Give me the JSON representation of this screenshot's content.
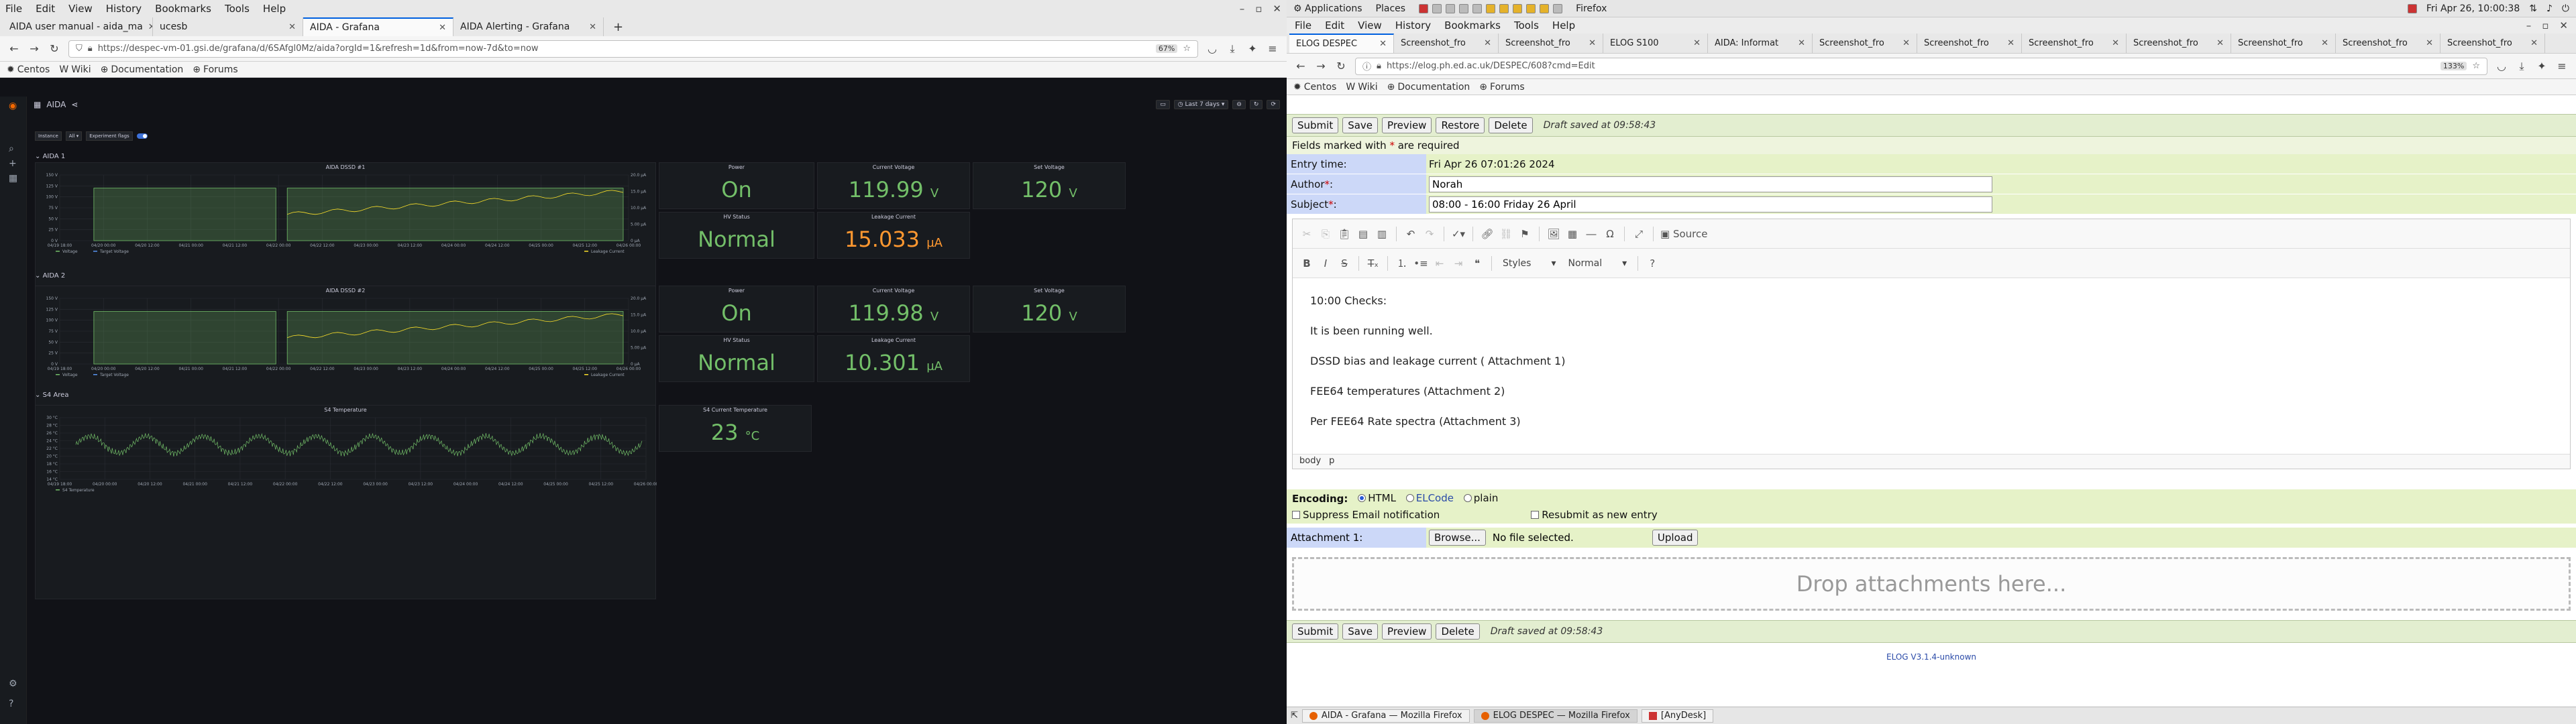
{
  "left_firefox": {
    "menu": [
      "File",
      "Edit",
      "View",
      "History",
      "Bookmarks",
      "Tools",
      "Help"
    ],
    "tabs": [
      {
        "title": "AIDA user manual - aida_ma"
      },
      {
        "title": "ucesb"
      },
      {
        "title": "AIDA - Grafana"
      },
      {
        "title": "AIDA Alerting - Grafana"
      }
    ],
    "url": "https://despec-vm-01.gsi.de/grafana/d/6SAfgl0Mz/aida?orgId=1&refresh=1d&from=now-7d&to=now",
    "zoom": "67%",
    "bookmarks": [
      "Centos",
      "Wiki",
      "Documentation",
      "Forums"
    ]
  },
  "grafana": {
    "title": "AIDA",
    "time_range": "Last 7 days",
    "vars": [
      "Instance",
      "All",
      "Experiment flags"
    ],
    "rows": [
      "AIDA 1",
      "AIDA 2",
      "S4 Area"
    ],
    "panels": {
      "dssd1_title": "AIDA DSSD #1",
      "dssd2_title": "AIDA DSSD #2",
      "s4_title": "S4 Temperature",
      "power_title": "Power",
      "current_voltage_title": "Current Voltage",
      "set_voltage_title": "Set Voltage",
      "hv_status_title": "HV Status",
      "leakage_title": "Leakage Current",
      "s4_current_temp_title": "S4 Current Temperature",
      "aida1": {
        "power": "On",
        "current_voltage": "119.99",
        "set_voltage": "120",
        "hv_status": "Normal",
        "leakage": "15.033"
      },
      "aida2": {
        "power": "On",
        "current_voltage": "119.98",
        "set_voltage": "120",
        "hv_status": "Normal",
        "leakage": "10.301"
      },
      "s4_temp": "23",
      "unit_v": "V",
      "unit_ua": "µA",
      "unit_c": "°C",
      "legend_voltage": "Voltage",
      "legend_target": "Target Voltage",
      "legend_leakage": "Leakage Current",
      "legend_s4": "S4 Temperature"
    },
    "dssd_axis": {
      "left_ticks": [
        "150 V",
        "125 V",
        "100 V",
        "75 V",
        "50 V",
        "25 V",
        "0 V"
      ],
      "right_ticks": [
        "20.0 µA",
        "15.0 µA",
        "10.0 µA",
        "5.00 µA",
        "0 µA"
      ],
      "x_ticks": [
        "04/19 18:00",
        "04/20 00:00",
        "04/20 12:00",
        "04/21 00:00",
        "04/21 12:00",
        "04/22 00:00",
        "04/22 12:00",
        "04/23 00:00",
        "04/23 12:00",
        "04/24 00:00",
        "04/24 12:00",
        "04/25 00:00",
        "04/25 12:00",
        "04/26 00:00"
      ]
    },
    "s4_axis": {
      "left_ticks": [
        "30 °C",
        "28 °C",
        "26 °C",
        "24 °C",
        "22 °C",
        "20 °C",
        "18 °C",
        "16 °C",
        "14 °C"
      ]
    },
    "colors": {
      "green": "#73bf69",
      "orange": "#ff9830",
      "yellow": "#fade2a",
      "bg": "#111217",
      "panel": "#181b1f"
    }
  },
  "gnome": {
    "applications": "Applications",
    "places": "Places",
    "app_name": "Firefox",
    "clock": "Fri Apr 26, 10:00:38"
  },
  "right_firefox": {
    "menu": [
      "File",
      "Edit",
      "View",
      "History",
      "Bookmarks",
      "Tools",
      "Help"
    ],
    "tabs": [
      {
        "title": "ELOG DESPEC"
      },
      {
        "title": "Screenshot_fro"
      },
      {
        "title": "Screenshot_fro"
      },
      {
        "title": "ELOG S100"
      },
      {
        "title": "AIDA: Informat"
      },
      {
        "title": "Screenshot_fro"
      },
      {
        "title": "Screenshot_fro"
      },
      {
        "title": "Screenshot_fro"
      },
      {
        "title": "Screenshot_fro"
      },
      {
        "title": "Screenshot_fro"
      },
      {
        "title": "Screenshot_fro"
      },
      {
        "title": "Screenshot_fro"
      }
    ],
    "url": "https://elog.ph.ed.ac.uk/DESPEC/608?cmd=Edit",
    "zoom": "133%",
    "bookmarks": [
      "Centos",
      "Wiki",
      "Documentation",
      "Forums"
    ]
  },
  "elog": {
    "buttons": {
      "submit": "Submit",
      "save": "Save",
      "preview": "Preview",
      "restore": "Restore",
      "delete": "Delete"
    },
    "draft_saved": "Draft saved at 09:58:43",
    "required_note_pre": "Fields marked with ",
    "required_star": "*",
    "required_note_post": " are required",
    "entry_time_label": "Entry time:",
    "entry_time": "Fri Apr 26 07:01:26 2024",
    "author_label": "Author",
    "author": "Norah",
    "subject_label": "Subject",
    "subject": "08:00 - 16:00 Friday 26 April",
    "styles_combo": "Styles",
    "format_combo": "Normal",
    "source_label": "Source",
    "body_lines": [
      "10:00 Checks:",
      "It is been running well.",
      "DSSD bias and  leakage current ( Attachment 1)",
      "FEE64 temperatures (Attachment 2)",
      "Per FEE64 Rate spectra (Attachment 3)"
    ],
    "path": [
      "body",
      "p"
    ],
    "encoding_label": "Encoding:",
    "encodings": [
      "HTML",
      "ELCode",
      "plain"
    ],
    "suppress_email": "Suppress Email notification",
    "resubmit": "Resubmit as new entry",
    "attachment_label": "Attachment 1:",
    "browse": "Browse...",
    "no_file": "No file selected.",
    "upload": "Upload",
    "drop_zone": "Drop attachments here...",
    "footer": "ELOG V3.1.4-unknown"
  },
  "taskbar": [
    {
      "label": "AIDA - Grafana — Mozilla Firefox"
    },
    {
      "label": "ELOG DESPEC — Mozilla Firefox"
    },
    {
      "label": "[AnyDesk]"
    }
  ]
}
